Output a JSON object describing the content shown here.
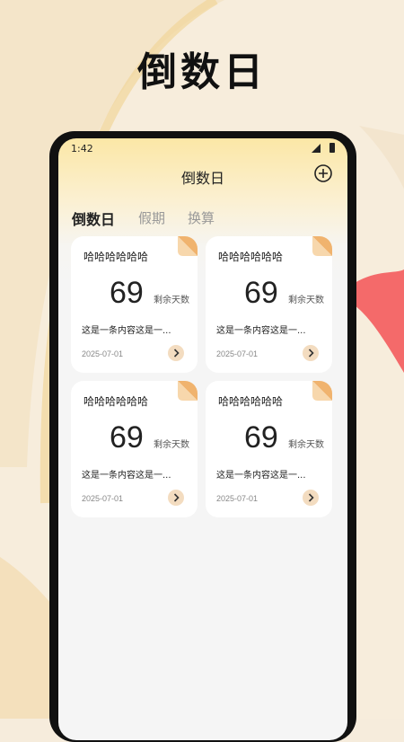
{
  "promo": {
    "title": "倒数日"
  },
  "status_bar": {
    "time": "1:42"
  },
  "header": {
    "title": "倒数日",
    "add_icon": "plus-circle-icon"
  },
  "tabs": [
    {
      "label": "倒数日",
      "active": true
    },
    {
      "label": "假期",
      "active": false
    },
    {
      "label": "换算",
      "active": false
    }
  ],
  "cards": [
    {
      "title": "哈哈哈哈哈哈",
      "days": "69",
      "unit": "剩余天数",
      "desc": "这是一条内容这是一...",
      "date": "2025-07-01"
    },
    {
      "title": "哈哈哈哈哈哈",
      "days": "69",
      "unit": "剩余天数",
      "desc": "这是一条内容这是一...",
      "date": "2025-07-01"
    },
    {
      "title": "哈哈哈哈哈哈",
      "days": "69",
      "unit": "剩余天数",
      "desc": "这是一条内容这是一...",
      "date": "2025-07-01"
    },
    {
      "title": "哈哈哈哈哈哈",
      "days": "69",
      "unit": "剩余天数",
      "desc": "这是一条内容这是一...",
      "date": "2025-07-01"
    }
  ],
  "colors": {
    "accent_corner": "#f0b36e",
    "arrow_bg": "#f3dcc0",
    "header_gradient": "#fbe7a6",
    "decor_red": "#f46a6a"
  }
}
